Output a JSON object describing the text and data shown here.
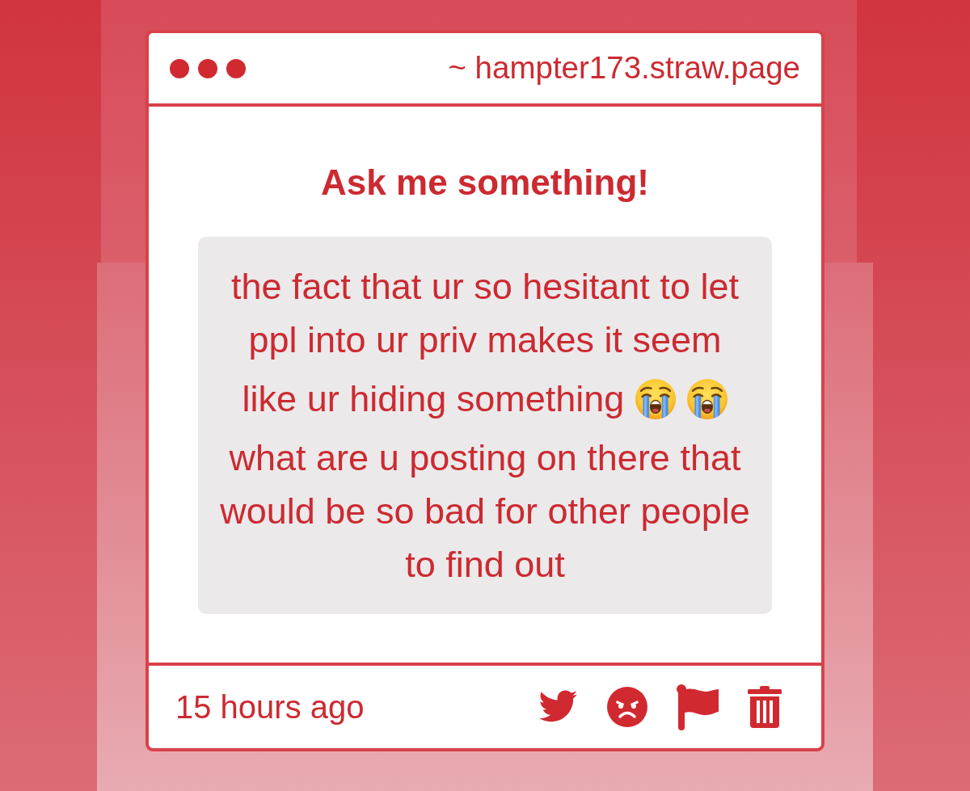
{
  "window": {
    "url": "~ hampter173.straw.page"
  },
  "prompt": {
    "title": "Ask me something!"
  },
  "question": {
    "blocks": [
      {
        "segments": [
          {
            "kind": "text",
            "text": "the fact that ur so hesitant to let ppl into ur priv makes it seem"
          }
        ]
      },
      {
        "segments": [
          {
            "kind": "text",
            "text": "like ur hiding something"
          },
          {
            "kind": "emoji"
          },
          {
            "kind": "emoji"
          }
        ]
      },
      {
        "segments": [
          {
            "kind": "text",
            "text": "what are u posting on there that would be so bad for other people to find out"
          }
        ]
      }
    ]
  },
  "footer": {
    "time": "15 hours ago"
  }
}
